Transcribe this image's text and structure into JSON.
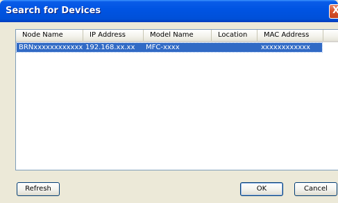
{
  "window": {
    "title": "Search for Devices",
    "close_glyph": "X"
  },
  "listview": {
    "columns": [
      "Node Name",
      "IP Address",
      "Model Name",
      "Location",
      "MAC Address"
    ],
    "rows": [
      {
        "node_name": "BRNxxxxxxxxxxxx",
        "ip_address": "192.168.xx.xx",
        "model_name": "MFC-xxxx",
        "location": "",
        "mac_address": "xxxxxxxxxxxx",
        "selected": true
      }
    ]
  },
  "buttons": {
    "refresh": "Refresh",
    "ok": "OK",
    "cancel": "Cancel"
  },
  "colors": {
    "selection": "#316ac5",
    "title_bar": "#0054e3",
    "dialog_face": "#ece9d8"
  }
}
